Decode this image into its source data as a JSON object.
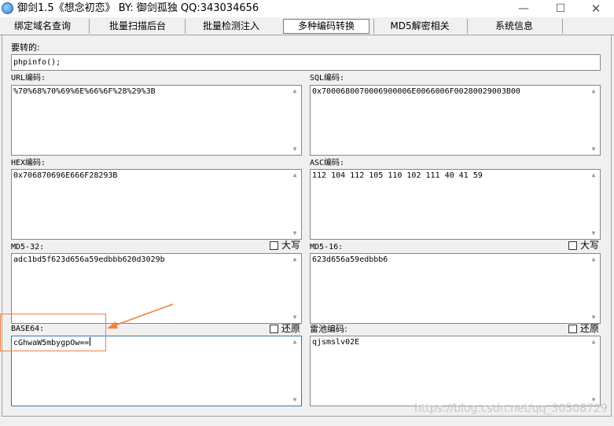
{
  "window": {
    "title": "御剑1.5《想念初恋》 BY: 御剑孤独 QQ:343034656",
    "minimize_glyph": "—",
    "maximize_glyph": "☐",
    "close_glyph": "✕"
  },
  "tabs": [
    {
      "label": "绑定域名查询"
    },
    {
      "label": "批量扫描后台"
    },
    {
      "label": "批量检测注入"
    },
    {
      "label": "多种编码转换",
      "active": true
    },
    {
      "label": "MD5解密相关"
    },
    {
      "label": "系统信息"
    }
  ],
  "input": {
    "label": "要转的:",
    "value": "phpinfo();"
  },
  "outputs": {
    "url": {
      "label": "URL编码:",
      "value": "%70%68%70%69%6E%66%6F%28%29%3B"
    },
    "sql": {
      "label": "SQL编码:",
      "value": "0x7000680070006900006E0066006F00280029003B00"
    },
    "hex": {
      "label": "HEX编码:",
      "value": "0x706870696E666F28293B"
    },
    "asc": {
      "label": "ASC编码:",
      "value": "112 104 112 105 110 102 111 40 41 59"
    },
    "md5_32": {
      "label": "MD5-32:",
      "value": "adc1bd5f623d656a59edbbb620d3029b",
      "checkbox_label": "大写"
    },
    "md5_16": {
      "label": "MD5-16:",
      "value": "623d656a59edbbb6",
      "checkbox_label": "大写"
    },
    "base64": {
      "label": "BASE64:",
      "value": "cGhwaW5mbygpOw==",
      "checkbox_label": "还原"
    },
    "leichi": {
      "label": "雷池编码:",
      "value": "qjsmslv02E",
      "checkbox_label": "还原"
    }
  },
  "icons": {
    "scroll_up": "▲",
    "scroll_down": "▼"
  },
  "colors": {
    "annotation": "#f08040",
    "focus_border": "#3a75b0"
  },
  "watermark": "https://blog.csdn.net/qq_30508729"
}
